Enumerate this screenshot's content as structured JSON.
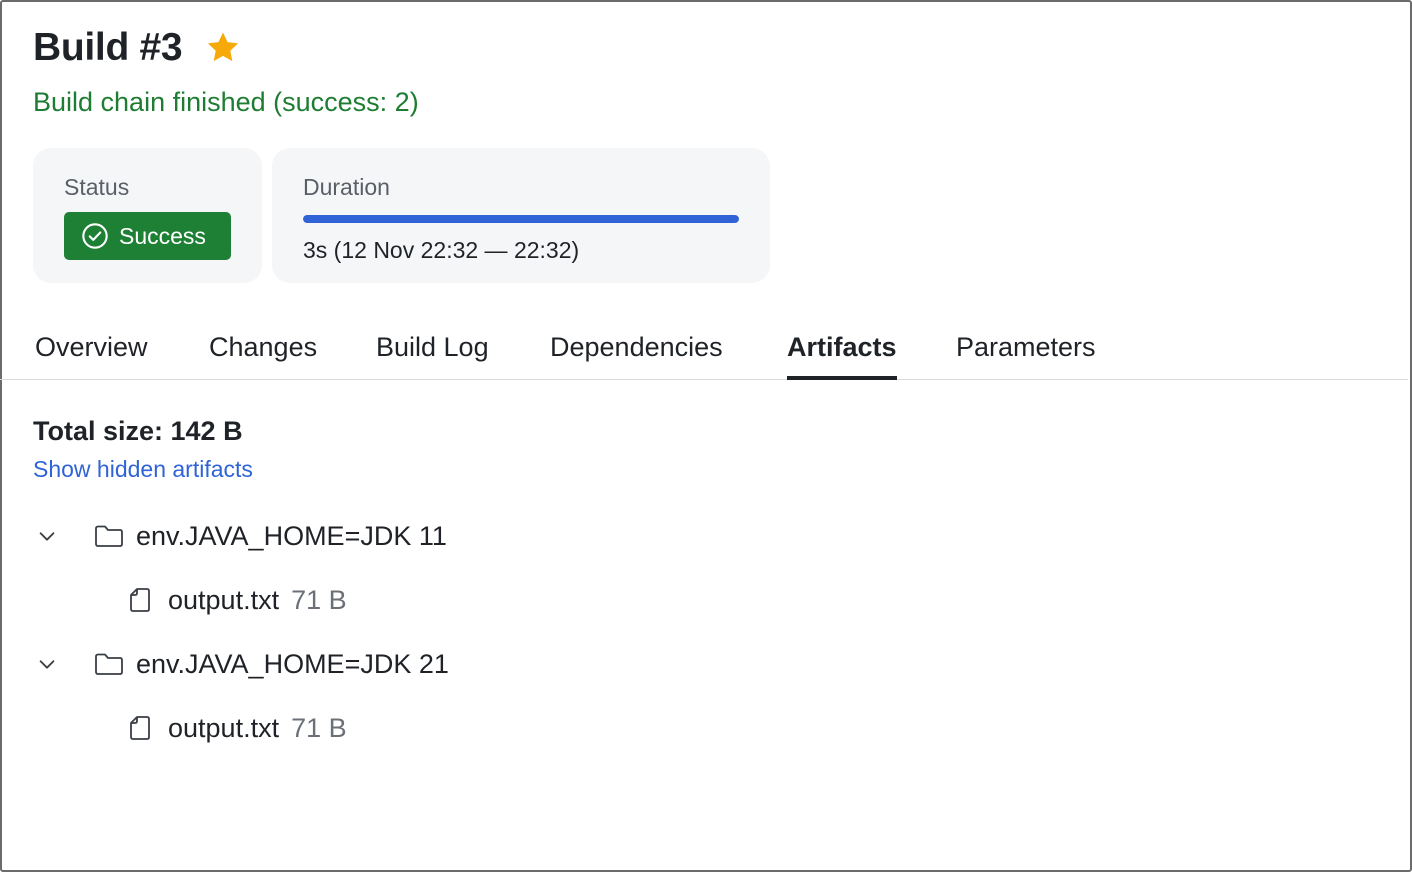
{
  "header": {
    "title": "Build #3",
    "subtitle": "Build chain finished (success: 2)"
  },
  "status_card": {
    "label": "Status",
    "badge": "Success"
  },
  "duration_card": {
    "label": "Duration",
    "progress": 1.0,
    "text": "3s (12 Nov 22:32 — 22:32)"
  },
  "tabs": [
    {
      "label": "Overview",
      "active": false
    },
    {
      "label": "Changes",
      "active": false
    },
    {
      "label": "Build Log",
      "active": false
    },
    {
      "label": "Dependencies",
      "active": false
    },
    {
      "label": "Artifacts",
      "active": true
    },
    {
      "label": "Parameters",
      "active": false
    }
  ],
  "artifacts": {
    "total_size": "Total size: 142 B",
    "show_hidden": "Show hidden artifacts",
    "folders": [
      {
        "name": "env.JAVA_HOME=JDK 11",
        "expanded": true,
        "files": [
          {
            "name": "output.txt",
            "size": "71 B"
          }
        ]
      },
      {
        "name": "env.JAVA_HOME=JDK 21",
        "expanded": true,
        "files": [
          {
            "name": "output.txt",
            "size": "71 B"
          }
        ]
      }
    ]
  },
  "colors": {
    "success": "#1e8035",
    "accent": "#2f63d6",
    "star": "#f7a90a"
  }
}
